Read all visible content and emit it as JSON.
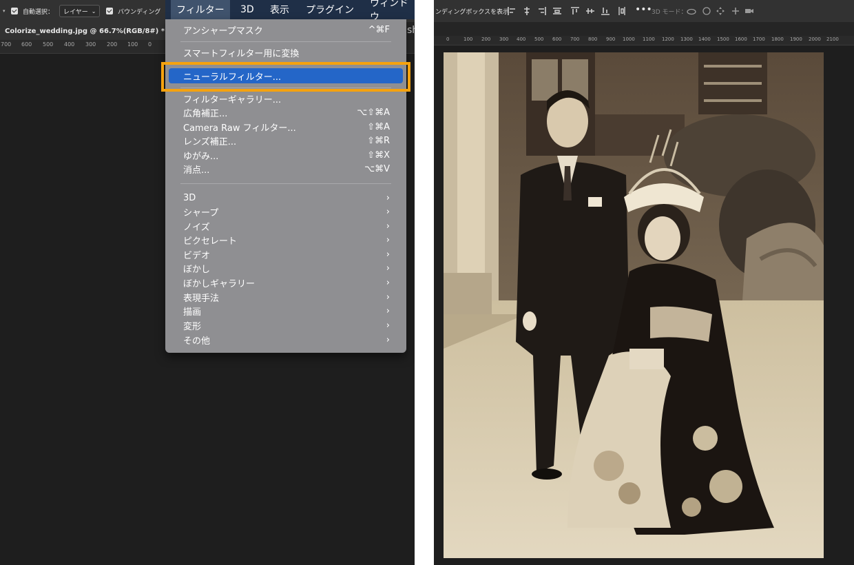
{
  "options_bar": {
    "auto_select_label": "自動選択：",
    "auto_select_target": "レイヤー",
    "bounding_label": "バウンディング",
    "bounding_full_label": "ンディングボックスを表示",
    "mode_label": "3D モード："
  },
  "menubar": {
    "items": [
      "フィルター",
      "3D",
      "表示",
      "プラグイン",
      "ウィンドウ"
    ]
  },
  "document": {
    "tab_title": "Colorize_wedding.jpg @ 66.7%(RGB/8#) *"
  },
  "ruler_left": [
    "700",
    "600",
    "500",
    "400",
    "300",
    "200",
    "100",
    "0"
  ],
  "ruler_right": [
    "0",
    "100",
    "200",
    "300",
    "400",
    "500",
    "600",
    "700",
    "800",
    "900",
    "1000",
    "1100",
    "1200",
    "1300",
    "1400",
    "1500",
    "1600",
    "1700",
    "1800",
    "1900",
    "2000",
    "2100"
  ],
  "filter_menu": {
    "unsharp_mask": {
      "label": "アンシャープマスク",
      "shortcut": "^⌘F"
    },
    "smart_filter": {
      "label": "スマートフィルター用に変換"
    },
    "neural_filter": {
      "label": "ニューラルフィルター..."
    },
    "filter_gallery": {
      "label": "フィルターギャラリー..."
    },
    "wide_angle": {
      "label": "広角補正...",
      "shortcut": "⌥⇧⌘A"
    },
    "camera_raw": {
      "label": "Camera Raw フィルター...",
      "shortcut": "⇧⌘A"
    },
    "lens_correction": {
      "label": "レンズ補正...",
      "shortcut": "⇧⌘R"
    },
    "liquify": {
      "label": "ゆがみ...",
      "shortcut": "⇧⌘X"
    },
    "vanishing_point": {
      "label": "消点...",
      "shortcut": "⌥⌘V"
    },
    "submenus": [
      "3D",
      "シャープ",
      "ノイズ",
      "ピクセレート",
      "ビデオ",
      "ぼかし",
      "ぼかしギャラリー",
      "表現手法",
      "描画",
      "変形",
      "その他"
    ]
  },
  "colors": {
    "menu_bg": "#8f8f92",
    "highlight": "#2466c8",
    "callout": "#f5a20e",
    "menubar": "#1f2f47"
  }
}
